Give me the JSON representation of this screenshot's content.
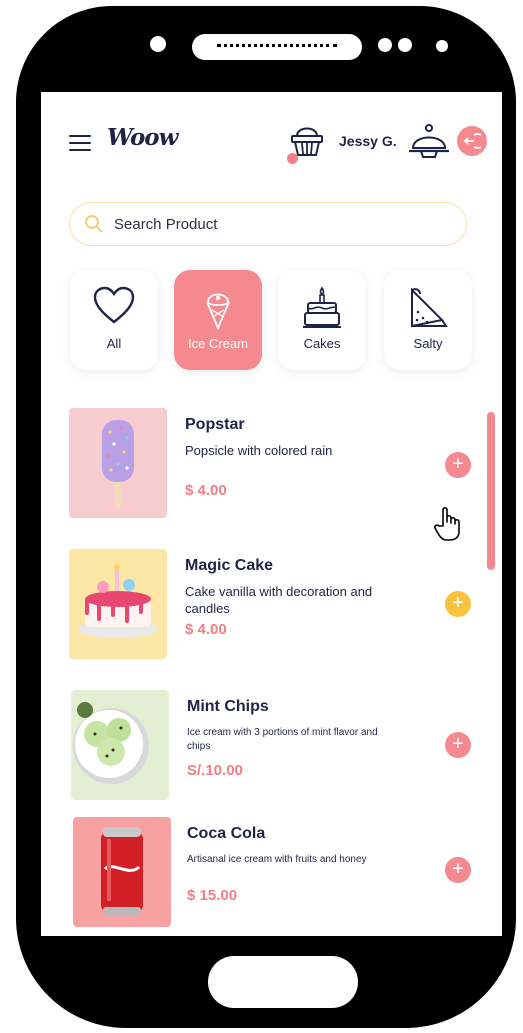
{
  "app": {
    "logo": "Woow",
    "username": "Jessy G."
  },
  "search": {
    "placeholder": "Search Product"
  },
  "categories": [
    {
      "label": "All",
      "icon": "heart-icon"
    },
    {
      "label": "Ice Cream",
      "icon": "ice-cream-cone-icon",
      "active": true
    },
    {
      "label": "Cakes",
      "icon": "cake-icon"
    },
    {
      "label": "Salty",
      "icon": "sandwich-icon"
    }
  ],
  "products": [
    {
      "name": "Popstar",
      "description": "Popsicle with colored rain",
      "price": "$ 4.00"
    },
    {
      "name": "Magic Cake",
      "description": "Cake vanilla with decoration and candles",
      "price": "$ 4.00"
    },
    {
      "name": "Mint Chips",
      "description": "Ice cream with 3 portions of mint flavor and chips",
      "price": "S/.10.00"
    },
    {
      "name": "Coca Cola",
      "description": "Artisanal ice cream with fruits and honey",
      "price": "$ 15.00"
    }
  ],
  "colors": {
    "accent": "#f48a90",
    "price": "#f47d86",
    "text": "#1f2446",
    "highlight": "#f7c33c"
  }
}
